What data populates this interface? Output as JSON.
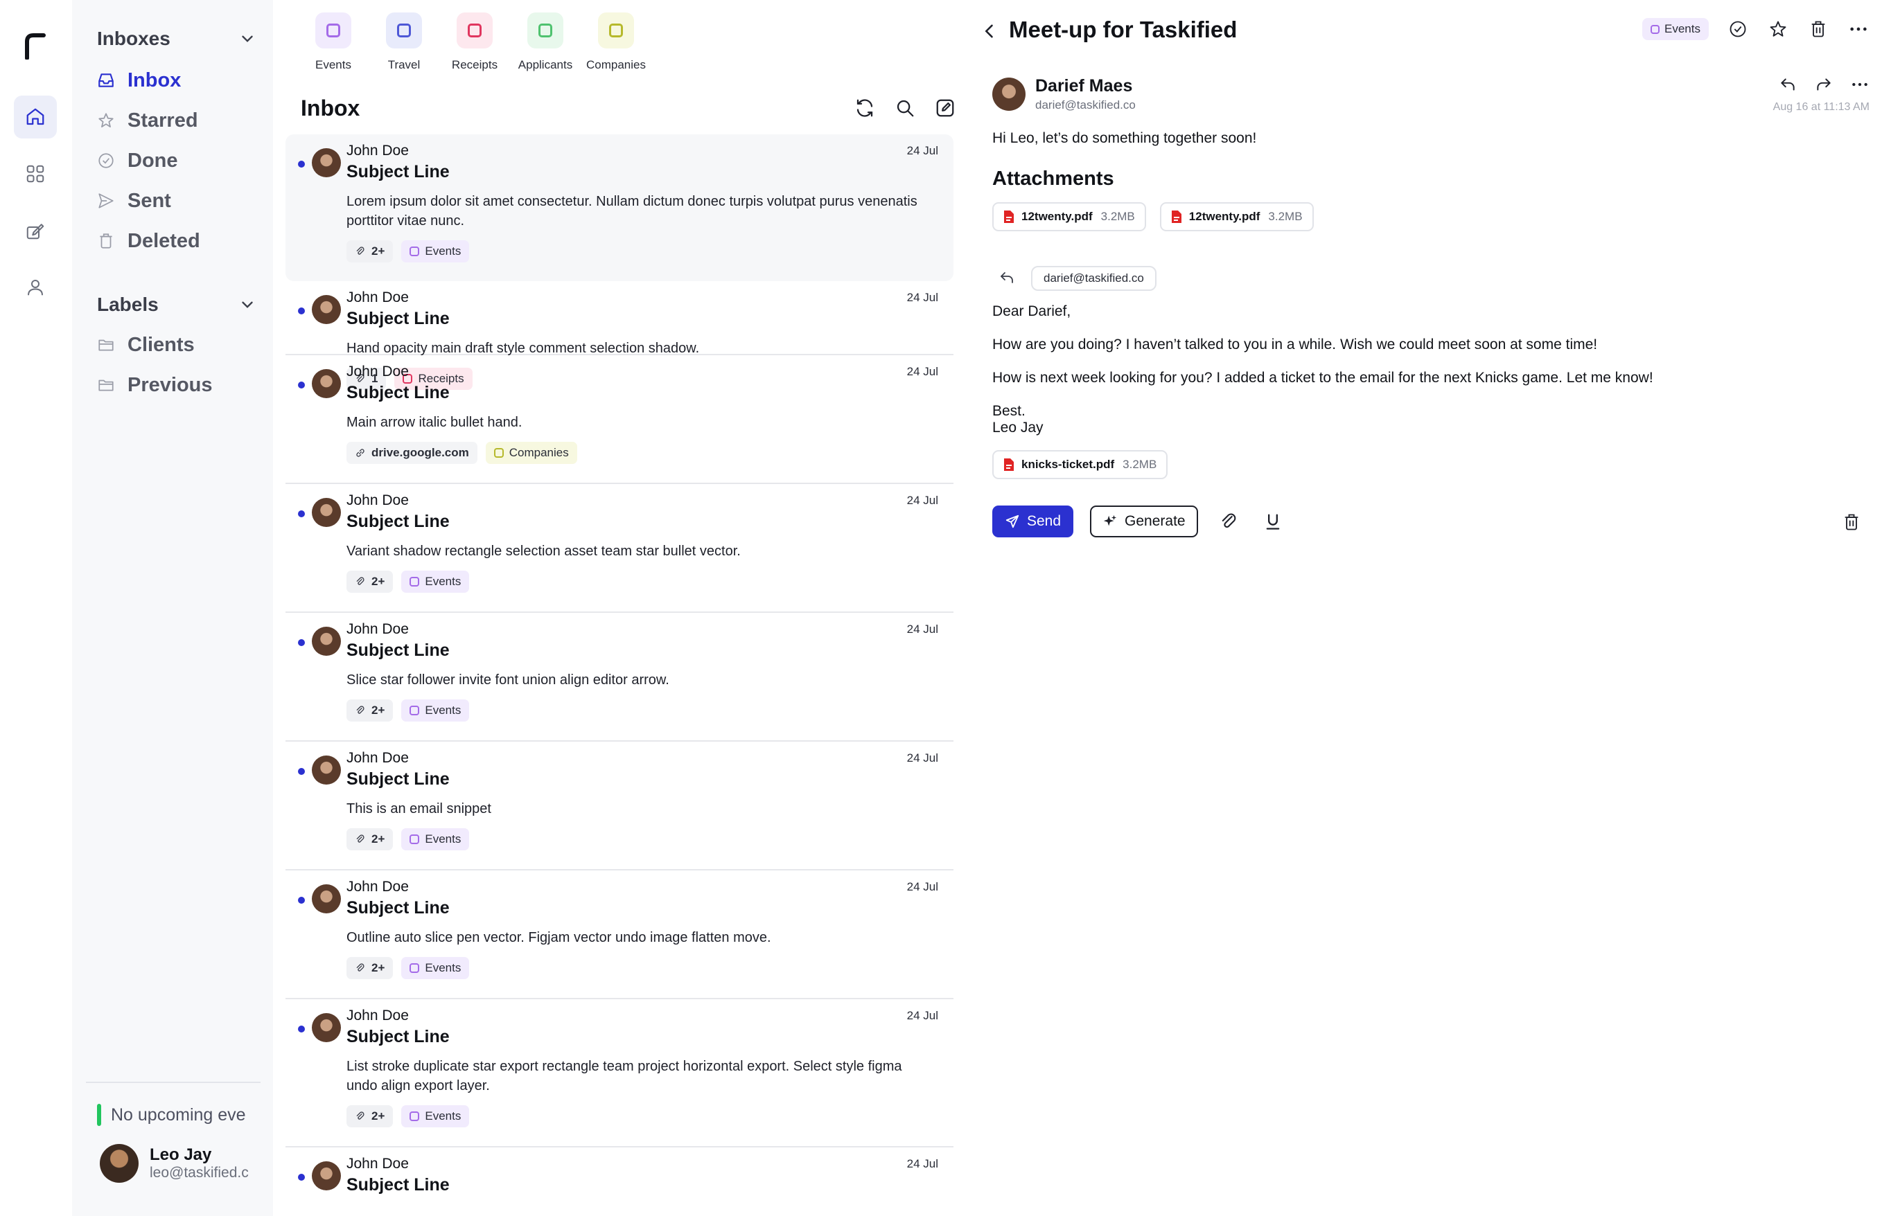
{
  "rail": {
    "items": [
      {
        "name": "home",
        "active": true
      },
      {
        "name": "apps",
        "active": false
      },
      {
        "name": "compose",
        "active": false
      },
      {
        "name": "profile",
        "active": false
      }
    ]
  },
  "sidebar": {
    "inboxes_label": "Inboxes",
    "items": [
      {
        "label": "Inbox",
        "icon": "inbox-icon",
        "active": true
      },
      {
        "label": "Starred",
        "icon": "star-icon",
        "active": false
      },
      {
        "label": "Done",
        "icon": "check-circle-icon",
        "active": false
      },
      {
        "label": "Sent",
        "icon": "send-icon",
        "active": false
      },
      {
        "label": "Deleted",
        "icon": "trash-icon",
        "active": false
      }
    ],
    "labels_label": "Labels",
    "labels": [
      {
        "label": "Clients",
        "icon": "folder-icon"
      },
      {
        "label": "Previous",
        "icon": "folder-icon"
      }
    ],
    "event_text": "No upcoming events",
    "user": {
      "name": "Leo Jay",
      "email": "leo@taskified.co"
    }
  },
  "categories": [
    {
      "label": "Events",
      "bg": "#f1ebfd",
      "color": "#a46be8"
    },
    {
      "label": "Travel",
      "bg": "#e8ebfb",
      "color": "#4e58d6"
    },
    {
      "label": "Receipts",
      "bg": "#fde8ee",
      "color": "#e0365f"
    },
    {
      "label": "Applicants",
      "bg": "#e8f8ec",
      "color": "#4fc26f"
    },
    {
      "label": "Companies",
      "bg": "#f7f8e0",
      "color": "#b6b92c"
    }
  ],
  "list": {
    "title": "Inbox",
    "emails": [
      {
        "from": "John Doe",
        "date": "24 Jul",
        "subject": "Subject Line",
        "snippet": "Lorem ipsum dolor sit amet consectetur. Nullam dictum donec turpis volutpat purus venenatis porttitor vitae nunc.",
        "attach": "2+",
        "tag": "Events",
        "selected": true
      },
      {
        "from": "John Doe",
        "date": "24 Jul",
        "subject": "Subject Line",
        "snippet": "Hand opacity main draft style comment selection shadow.",
        "attach": "1",
        "tag": "Receipts",
        "selected": false
      },
      {
        "from": "John Doe",
        "date": "24 Jul",
        "subject": "Subject Line",
        "snippet": "Main arrow italic bullet hand.",
        "attach": "drive.google.com",
        "tag": "Companies",
        "selected": false
      },
      {
        "from": "John Doe",
        "date": "24 Jul",
        "subject": "Subject Line",
        "snippet": "Variant shadow rectangle selection asset team star bullet vector.",
        "attach": "2+",
        "tag": "Events",
        "selected": false
      },
      {
        "from": "John Doe",
        "date": "24 Jul",
        "subject": "Subject Line",
        "snippet": "Slice star follower invite font union align editor arrow.",
        "attach": "2+",
        "tag": "Events",
        "selected": false
      },
      {
        "from": "John Doe",
        "date": "24 Jul",
        "subject": "Subject Line",
        "snippet": "This is an email snippet",
        "attach": "2+",
        "tag": "Events",
        "selected": false
      },
      {
        "from": "John Doe",
        "date": "24 Jul",
        "subject": "Subject Line",
        "snippet": "Outline auto slice pen vector. Figjam vector undo image flatten move.",
        "attach": "2+",
        "tag": "Events",
        "selected": false
      },
      {
        "from": "John Doe",
        "date": "24 Jul",
        "subject": "Subject Line",
        "snippet": "List stroke duplicate star export rectangle team project horizontal export. Select style figma undo align export layer.",
        "attach": "2+",
        "tag": "Events",
        "selected": false
      },
      {
        "from": "John Doe",
        "date": "24 Jul",
        "subject": "Subject Line",
        "snippet": "",
        "attach": "",
        "tag": "",
        "selected": false
      }
    ]
  },
  "reader": {
    "title": "Meet-up for Taskified",
    "tag": "Events",
    "sender": {
      "name": "Darief Maes",
      "email": "darief@taskified.co"
    },
    "date": "Aug 16 at 11:13 AM",
    "greeting": "Hi Leo, let’s do something together soon!",
    "attachments_title": "Attachments",
    "attachments": [
      {
        "name": "12twenty.pdf",
        "size": "3.2MB"
      },
      {
        "name": "12twenty.pdf",
        "size": "3.2MB"
      }
    ],
    "reply_to": "darief@taskified.co",
    "compose": {
      "salutation": "Dear Darief,",
      "p1": "How are you doing? I haven’t talked to you in a while. Wish we could meet soon at some time!",
      "p2": "How is next week looking for you? I added a ticket to the email for the next Knicks game. Let me know!",
      "sign1": "Best.",
      "sign2": "Leo Jay",
      "attachment": {
        "name": "knicks-ticket.pdf",
        "size": "3.2MB"
      }
    },
    "send_label": "Send",
    "generate_label": "Generate"
  },
  "colors": {
    "accent": "#2b31d0",
    "pdf_red": "#e02424",
    "event_green": "#22c55e"
  }
}
